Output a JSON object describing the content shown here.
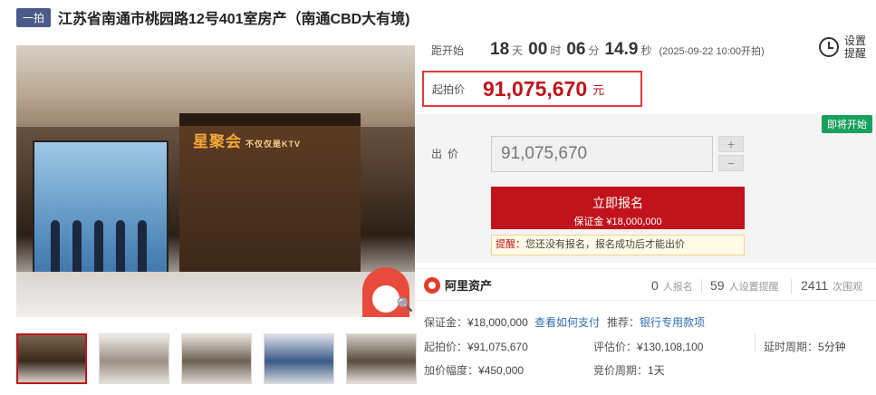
{
  "header": {
    "badge": "一拍",
    "title": "江苏省南通市桃园路12号401室房产（南通CBD大有境)"
  },
  "gallery": {
    "store_sign": "星聚会",
    "store_sign_sub": "不仅仅是KTV",
    "zoom_icon": "zoom-icon",
    "thumbnails": 5,
    "active_thumb": 1
  },
  "countdown": {
    "label": "距开始",
    "days": "18",
    "days_unit": "天",
    "hours": "00",
    "hours_unit": "时",
    "minutes": "06",
    "minutes_unit": "分",
    "seconds": "14.9",
    "seconds_unit": "秒",
    "start_time": "(2025-09-22 10:00开拍)"
  },
  "remind": {
    "label": "设置提醒",
    "icon": "alarm-clock-icon"
  },
  "start_price": {
    "label": "起拍价",
    "value": "91,075,670",
    "unit": "元"
  },
  "status_tag": "即将开始",
  "bid": {
    "label": "出价",
    "value": "91,075,670",
    "plus": "+",
    "minus": "−"
  },
  "signup": {
    "label": "立即报名",
    "deposit": "保证金 ¥18,000,000"
  },
  "hint": {
    "prefix": "提醒：",
    "text": "您还没有报名，报名成功后才能出价"
  },
  "platform": {
    "name": "阿里资产",
    "logo_icon": "alibaba-logo-icon"
  },
  "stats": {
    "signups": "0",
    "signups_label": "人报名",
    "reminders": "59",
    "reminders_label": "人设置提醒",
    "views": "2411",
    "views_label": "次围观"
  },
  "details": {
    "deposit_label": "保证金：",
    "deposit": "¥18,000,000",
    "how_to_pay": "查看如何支付",
    "recommend_label": "推荐：",
    "recommend": "银行专用款项",
    "start_price_label": "起拍价：",
    "start_price": "¥91,075,670",
    "appraisal_label": "评估价：",
    "appraisal": "¥130,108,100",
    "delay_label": "延时周期：",
    "delay": "5分钟",
    "increment_label": "加价幅度：",
    "increment": "¥450,000",
    "cycle_label": "竞价周期：",
    "cycle": "1天"
  },
  "colors": {
    "accent_red": "#c0131b",
    "link_blue": "#2c6fb3",
    "tag_green": "#1aa05e",
    "badge_navy": "#4a5a8a"
  }
}
